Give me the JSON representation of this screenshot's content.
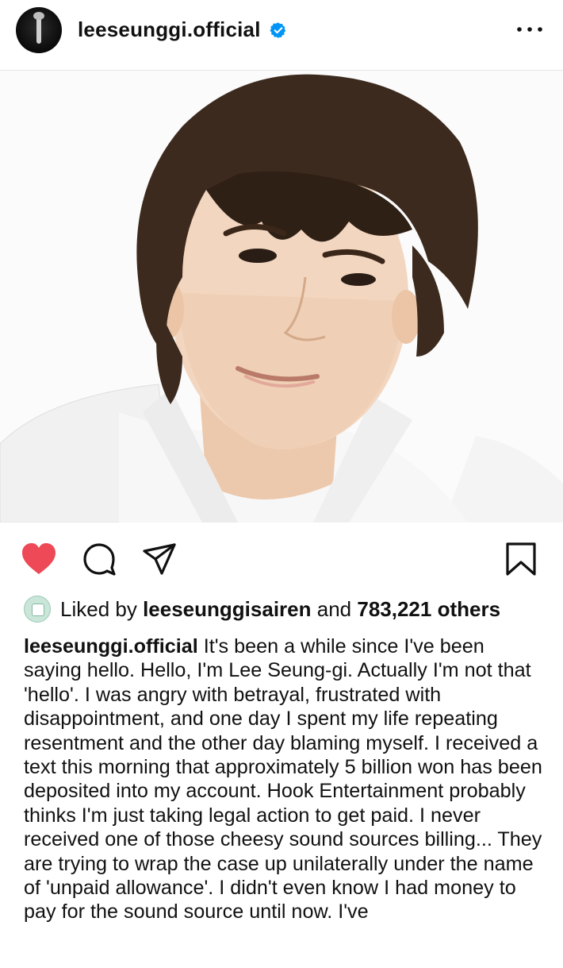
{
  "post": {
    "username": "leeseunggi.official",
    "verified": true,
    "more_icon": "more-horizontal-icon"
  },
  "actions": {
    "like_icon": "heart-filled-icon",
    "comment_icon": "comment-icon",
    "share_icon": "paper-plane-icon",
    "save_icon": "bookmark-icon",
    "like_color": "#ed4956"
  },
  "likes": {
    "prefix": "Liked by",
    "user": "leeseunggisairen",
    "middle": "and",
    "count": "783,221 others"
  },
  "caption": {
    "username": "leeseunggi.official",
    "text": "It's been a while since I've been saying hello. Hello, I'm Lee Seung-gi. Actually I'm not that 'hello'. I was angry with betrayal, frustrated with disappointment, and one day I spent my life repeating resentment and the other day blaming myself. I received a text this morning that approximately 5 billion won has been deposited into my account. Hook Entertainment probably thinks I'm just taking legal action to get paid. I never received one of those cheesy sound sources billing... They are trying to wrap the case up unilaterally under the name of 'unpaid allowance'. I didn't even know I had money to pay for the sound source until now. I've"
  },
  "colors": {
    "verified_blue": "#0095f6",
    "divider": "#e6e6e6"
  }
}
